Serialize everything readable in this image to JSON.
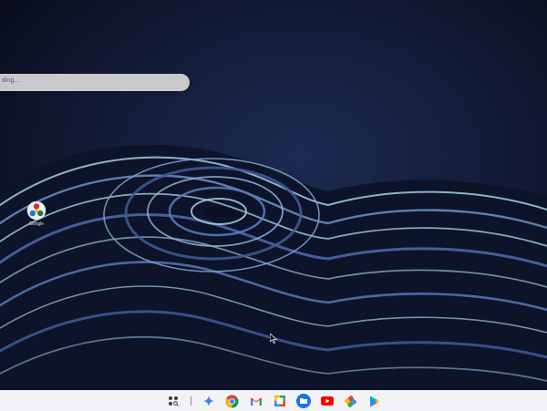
{
  "desktop": {
    "loading_text": "ding...",
    "shortcut_label": "Google"
  },
  "shelf": {
    "items": [
      {
        "icon": "launcher-icon"
      },
      {
        "icon": "gemini-icon"
      },
      {
        "icon": "chrome-icon"
      },
      {
        "icon": "gmail-icon"
      },
      {
        "icon": "google-docs-icon"
      },
      {
        "icon": "files-icon"
      },
      {
        "icon": "youtube-icon"
      },
      {
        "icon": "google-photos-icon"
      },
      {
        "icon": "google-play-icon"
      }
    ]
  },
  "colors": {
    "wallpaper_bg": "#0b1022",
    "shelf_bg": "#f2f3f7",
    "wave_light": "#8fb6d6",
    "wave_dark": "#0a0f22"
  }
}
